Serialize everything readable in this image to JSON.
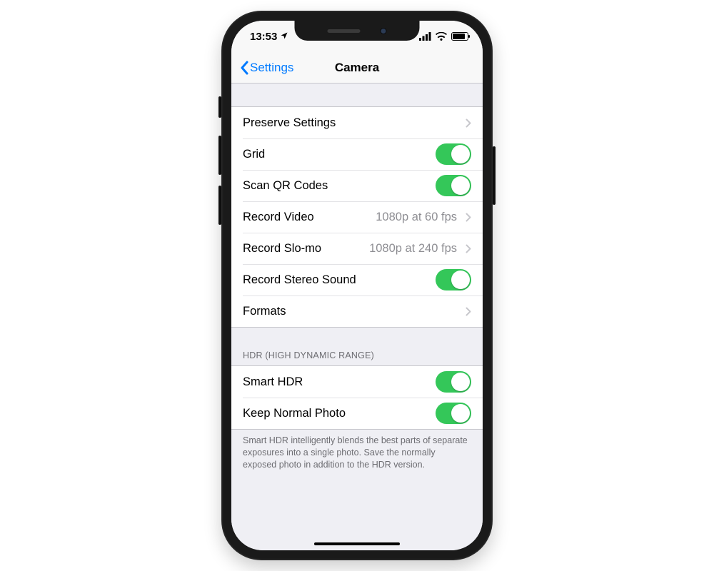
{
  "statusbar": {
    "time": "13:53"
  },
  "nav": {
    "back_label": "Settings",
    "title": "Camera"
  },
  "section1": {
    "rows": [
      {
        "label": "Preserve Settings"
      },
      {
        "label": "Grid"
      },
      {
        "label": "Scan QR Codes"
      },
      {
        "label": "Record Video",
        "value": "1080p at 60 fps"
      },
      {
        "label": "Record Slo-mo",
        "value": "1080p at 240 fps"
      },
      {
        "label": "Record Stereo Sound"
      },
      {
        "label": "Formats"
      }
    ],
    "toggles": {
      "grid": true,
      "scan_qr_codes": true,
      "record_stereo_sound": true
    }
  },
  "section2": {
    "header": "HDR (HIGH DYNAMIC RANGE)",
    "rows": {
      "smart_hdr_label": "Smart HDR",
      "keep_normal_label": "Keep Normal Photo"
    },
    "toggles": {
      "smart_hdr": true,
      "keep_normal_photo": true
    },
    "footer": "Smart HDR intelligently blends the best parts of separate exposures into a single photo. Save the normally exposed photo in addition to the HDR version."
  }
}
